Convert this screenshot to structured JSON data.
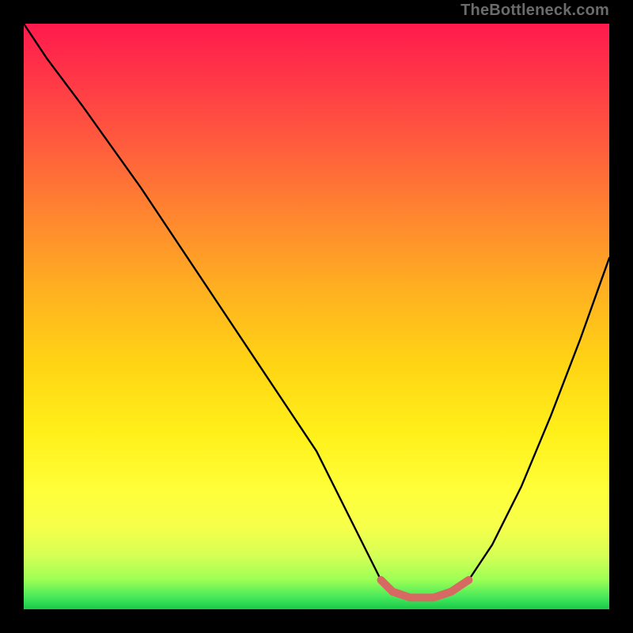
{
  "watermark": "TheBottleneck.com",
  "chart_data": {
    "type": "line",
    "title": "",
    "xlabel": "",
    "ylabel": "",
    "xlim": [
      0,
      100
    ],
    "ylim": [
      0,
      100
    ],
    "series": [
      {
        "name": "curve",
        "x": [
          0,
          4,
          10,
          20,
          30,
          40,
          50,
          58,
          61,
          63,
          66,
          68,
          70,
          73,
          76,
          80,
          85,
          90,
          95,
          100
        ],
        "y": [
          100,
          94,
          86,
          72,
          57,
          42,
          27,
          11,
          5,
          3,
          2,
          2,
          2,
          3,
          5,
          11,
          21,
          33,
          46,
          60
        ]
      },
      {
        "name": "valley-highlight",
        "x": [
          61,
          63,
          66,
          68,
          70,
          73,
          76
        ],
        "y": [
          5,
          3,
          2,
          2,
          2,
          3,
          5
        ]
      }
    ],
    "gradient_stops": [
      {
        "pos": 0,
        "color": "#ff1a4d"
      },
      {
        "pos": 8,
        "color": "#ff3348"
      },
      {
        "pos": 20,
        "color": "#ff5a3e"
      },
      {
        "pos": 34,
        "color": "#ff8a2e"
      },
      {
        "pos": 46,
        "color": "#ffb220"
      },
      {
        "pos": 58,
        "color": "#ffd414"
      },
      {
        "pos": 70,
        "color": "#fff01a"
      },
      {
        "pos": 80,
        "color": "#ffff3a"
      },
      {
        "pos": 86,
        "color": "#f6ff4a"
      },
      {
        "pos": 91,
        "color": "#d4ff55"
      },
      {
        "pos": 95,
        "color": "#9cff55"
      },
      {
        "pos": 98,
        "color": "#44e85a"
      },
      {
        "pos": 100,
        "color": "#18c94a"
      }
    ],
    "highlight_color": "#d66a63",
    "curve_color": "#000000"
  }
}
